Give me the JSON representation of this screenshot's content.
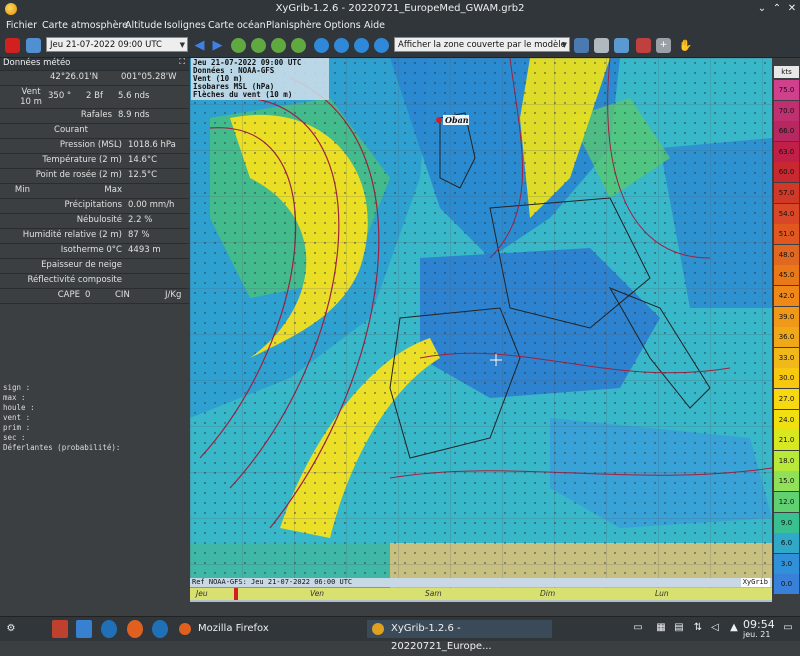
{
  "window": {
    "title": "XyGrib-1.2.6 - 20220721_EuropeMed_GWAM.grb2"
  },
  "menu": [
    "Fichier",
    "Carte atmosphère",
    "Altitude",
    "Isolignes",
    "Carte océan",
    "Planisphère",
    "Options",
    "Aide"
  ],
  "toolbar": {
    "date_select": "Jeu 21-07-2022 09:00 UTC",
    "zone_select": "Afficher la zone couverte par le modèle"
  },
  "side": {
    "header": "Données météo",
    "lat": "42°26.01'N",
    "lon": "001°05.28'W",
    "wind_label": "Vent\n10 m",
    "wind_dir": "350 °",
    "wind_bf": "2 Bf",
    "wind_speed": "5.6  nds",
    "gust_label": "Rafales",
    "gust_value": "8.9  nds",
    "current_label": "Courant",
    "pressure_label": "Pression (MSL)",
    "pressure_value": "1018.6 hPa",
    "temp_label": "Température (2 m)",
    "temp_value": "14.6°C",
    "dew_label": "Point de rosée (2 m)",
    "dew_value": "12.5°C",
    "min_label": "Min",
    "max_label": "Max",
    "precip_label": "Précipitations",
    "precip_value": "0.00 mm/h",
    "cloud_label": "Nébulosité",
    "cloud_value": "2.2 %",
    "humidity_label": "Humidité relative (2 m)",
    "humidity_value": "87 %",
    "iso0_label": "Isotherme 0°C",
    "iso0_value": "4493 m",
    "snow_label": "Epaisseur de neige",
    "reflect_label": "Réflectivité composite",
    "cape_label": "CAPE",
    "cape_value": "0",
    "cin_label": "CIN",
    "jkg_label": "J/Kg"
  },
  "infobox": [
    "sign :",
    "max :",
    "houle :",
    "vent :",
    "prim :",
    "sec :",
    "Déferlantes (probabilité):"
  ],
  "map": {
    "info_lines": [
      "Jeu 21-07-2022 09:00 UTC",
      "Données : NOAA-GFS",
      "Vent (10 m)",
      "Isobares MSL (hPa)",
      "Flèches du vent (10 m)"
    ],
    "city": "Oban",
    "ref_text": "Ref NOAA-GFS: Jeu 21-07-2022 06:00 UTC",
    "brand": "XyGrib",
    "timeline_days": [
      "Jeu",
      "Ven",
      "Sam",
      "Dim",
      "Lun"
    ]
  },
  "legend": {
    "unit": "kts",
    "values": [
      "75.0",
      "70.0",
      "66.0",
      "63.0",
      "60.0",
      "57.0",
      "54.0",
      "51.0",
      "48.0",
      "45.0",
      "42.0",
      "39.0",
      "36.0",
      "33.0",
      "30.0",
      "27.0",
      "24.0",
      "21.0",
      "18.0",
      "15.0",
      "12.0",
      "9.0",
      "6.0",
      "3.0",
      "0.0"
    ],
    "colors": [
      "#d0408c",
      "#c03070",
      "#b82860",
      "#c02048",
      "#c82830",
      "#d03828",
      "#d84828",
      "#e05820",
      "#e06820",
      "#e87818",
      "#f08818",
      "#f09818",
      "#f0a818",
      "#f0b818",
      "#f8c810",
      "#f8d810",
      "#f0e010",
      "#d8e820",
      "#b8e838",
      "#90e058",
      "#60d070",
      "#38c090",
      "#30a8c8",
      "#3090d8",
      "#3880d8"
    ]
  },
  "taskbar": {
    "firefox": "Mozilla Firefox",
    "xygrib": "XyGrib-1.2.6 - 20220721_Europe...",
    "time": "09:54",
    "date": "jeu. 21"
  }
}
